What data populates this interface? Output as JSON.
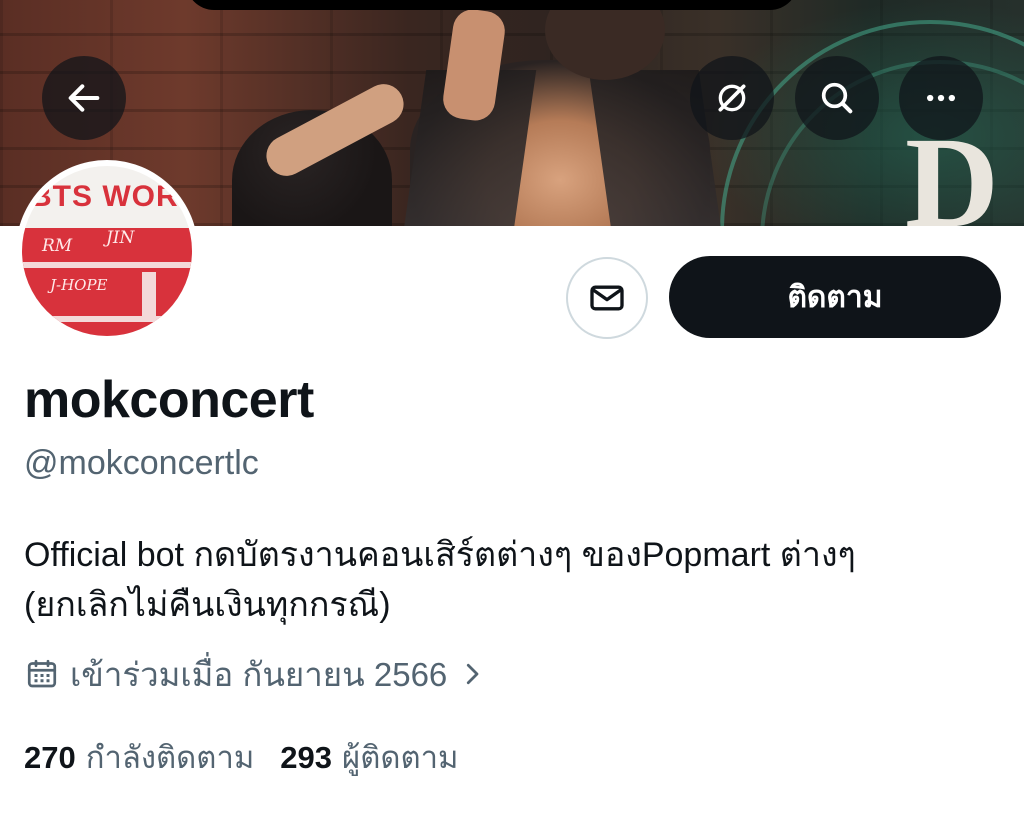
{
  "profile": {
    "display_name": "mokconcert",
    "handle": "@mokconcertlc",
    "bio_line1": "Official bot กดบัตรงานคอนเสิร์ตต่างๆ ของPopmart ต่างๆ",
    "bio_line2": "(ยกเลิกไม่คืนเงินทุกกรณี)",
    "joined": "เข้าร่วมเมื่อ กันยายน 2566",
    "following_count": "270",
    "following_label": "กำลังติดตาม",
    "followers_count": "293",
    "followers_label": "ผู้ติดตาม"
  },
  "avatar": {
    "title": "BTS WORLD",
    "handwriting": [
      "RM",
      "JIN",
      "J-HOPE"
    ]
  },
  "banner": {
    "stage_letter": "D"
  },
  "actions": {
    "follow_label": "ติดตาม"
  },
  "icons": {
    "back": "arrow-left-icon",
    "translate": "translate-off-icon",
    "search": "search-icon",
    "more": "more-dots-icon",
    "message": "envelope-icon",
    "calendar": "calendar-icon",
    "chevron": "chevron-right-icon"
  },
  "colors": {
    "text_primary": "#0f1419",
    "text_secondary": "#536471",
    "follow_bg": "#0f1419",
    "avatar_red": "#d8323c"
  }
}
